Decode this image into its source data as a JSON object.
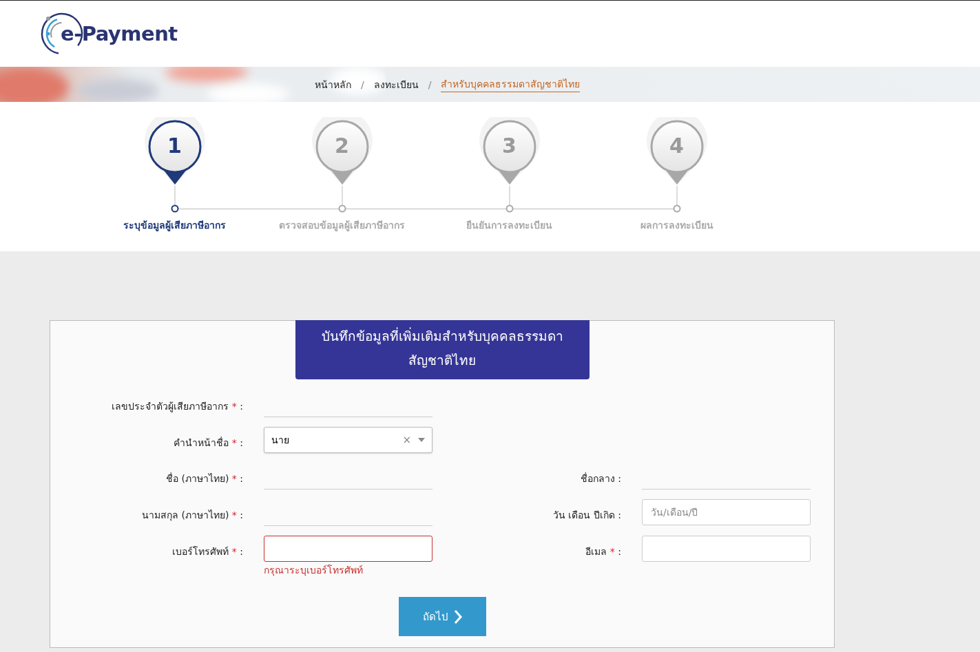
{
  "header": {
    "logo_text": "e-Payment"
  },
  "breadcrumb_separator": "/",
  "breadcrumb": [
    {
      "label": "หน้าหลัก",
      "current": false
    },
    {
      "label": "ลงทะเบียน",
      "current": false
    },
    {
      "label": "สำหรับบุคคลธรรมดาสัญชาติไทย",
      "current": true
    }
  ],
  "steps": [
    {
      "number": "1",
      "label": "ระบุข้อมูลผู้เสียภาษีอากร",
      "selected": true
    },
    {
      "number": "2",
      "label": "ตรวจสอบข้อมูลผู้เสียภาษีอากร",
      "selected": false
    },
    {
      "number": "3",
      "label": "ยืนยันการลงทะเบียน",
      "selected": false
    },
    {
      "number": "4",
      "label": "ผลการลงทะเบียน",
      "selected": false
    }
  ],
  "form": {
    "title_lines": [
      "บันทึกข้อมูลที่เพิ่มเติมสำหรับบุคคลธรรมดา",
      "สัญชาติไทย"
    ],
    "rows": [
      [
        {
          "label": "เลขประจำตัวผู้เสียภาษีอากร",
          "required": true,
          "kind": "line"
        }
      ],
      [
        {
          "label": "คำนำหน้าชื่อ",
          "required": true,
          "kind": "select",
          "value": "นาย",
          "clear": "×"
        }
      ],
      [
        {
          "label": "ชื่อ (ภาษาไทย)",
          "required": true,
          "kind": "line"
        },
        {
          "label": "ชื่อกลาง",
          "required": false,
          "kind": "line"
        }
      ],
      [
        {
          "label": "นามสกุล (ภาษาไทย)",
          "required": true,
          "kind": "line"
        },
        {
          "label": "วัน เดือน ปีเกิด",
          "required": false,
          "kind": "input",
          "placeholder": "วัน/เดือน/ปี"
        }
      ],
      [
        {
          "label": "เบอร์โทรศัพท์",
          "required": true,
          "kind": "input",
          "error": "กรุณาระบุเบอร์โทรศัพท์"
        },
        {
          "label": "อีเมล",
          "required": true,
          "kind": "input"
        }
      ]
    ],
    "required_mark": "*",
    "separator": ":",
    "next_button": "ถัดไป"
  }
}
